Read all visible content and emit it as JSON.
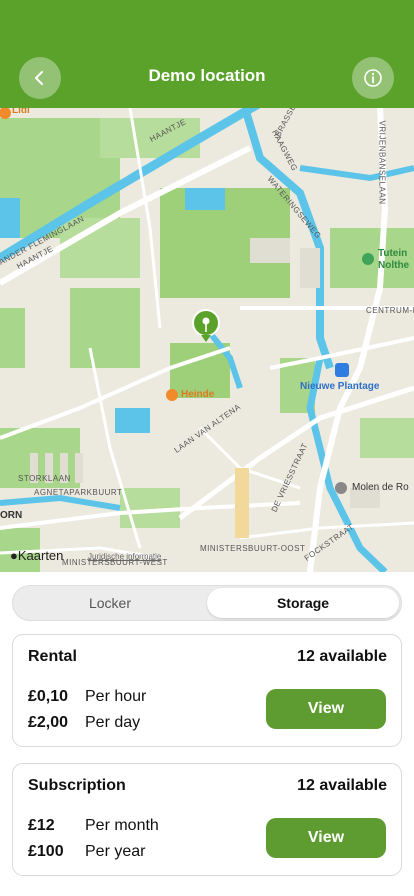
{
  "header": {
    "title": "Demo location",
    "back_icon": "chevron-left-icon",
    "info_icon": "info-icon",
    "color": "#5aa22a"
  },
  "map": {
    "labels": {
      "lidl": "Lidl",
      "haantje1": "HAANTJE",
      "haantje2": "HAANTJE",
      "brassi": "BRASSE",
      "vrijenbanselaan": "VRIJENBANSELAAN",
      "haagweg": "HAAGWEG",
      "wateringseweg": "WATERINGSEWEG",
      "fleminglaan": "ANDER FLEMINGLAAN",
      "tutein": "Tutein",
      "nolthe": "Nolthe",
      "centrum_noord": "CENTRUM-NOORD",
      "nieuwe_plantage": "Nieuwe Plantage",
      "heinde": "Heinde",
      "laan_van_altena": "LAAN VAN ALTENA",
      "storklaan": "STORKLAAN",
      "agnetaparkbuurt": "AGNETAPARKBUURT",
      "orn": "ORN",
      "de_vriesstraat": "DE VRIESSTRAAT",
      "molen": "Molen de Ro",
      "kaarten": "Kaarten",
      "juridische": "Juridische informatie",
      "ministersbuurt_west": "MINISTERSBUURT-WEST",
      "ministersbuurt_oost": "MINISTERSBUURT-OOST",
      "fockstraat": "FOCKSTRAAT"
    }
  },
  "tabs": {
    "locker": "Locker",
    "storage": "Storage",
    "selected": "Storage"
  },
  "rental": {
    "title": "Rental",
    "available": "12 available",
    "rows": [
      {
        "price": "£0,10",
        "period": "Per hour"
      },
      {
        "price": "£2,00",
        "period": "Per day"
      }
    ],
    "button": "View"
  },
  "subscription": {
    "title": "Subscription",
    "available": "12 available",
    "rows": [
      {
        "price": "£12",
        "period": "Per month"
      },
      {
        "price": "£100",
        "period": "Per year"
      }
    ],
    "button": "View"
  },
  "colors": {
    "primary": "#5aa22a",
    "button": "#5e9c32",
    "water": "#5cc4e8",
    "park": "#9ed07a"
  }
}
